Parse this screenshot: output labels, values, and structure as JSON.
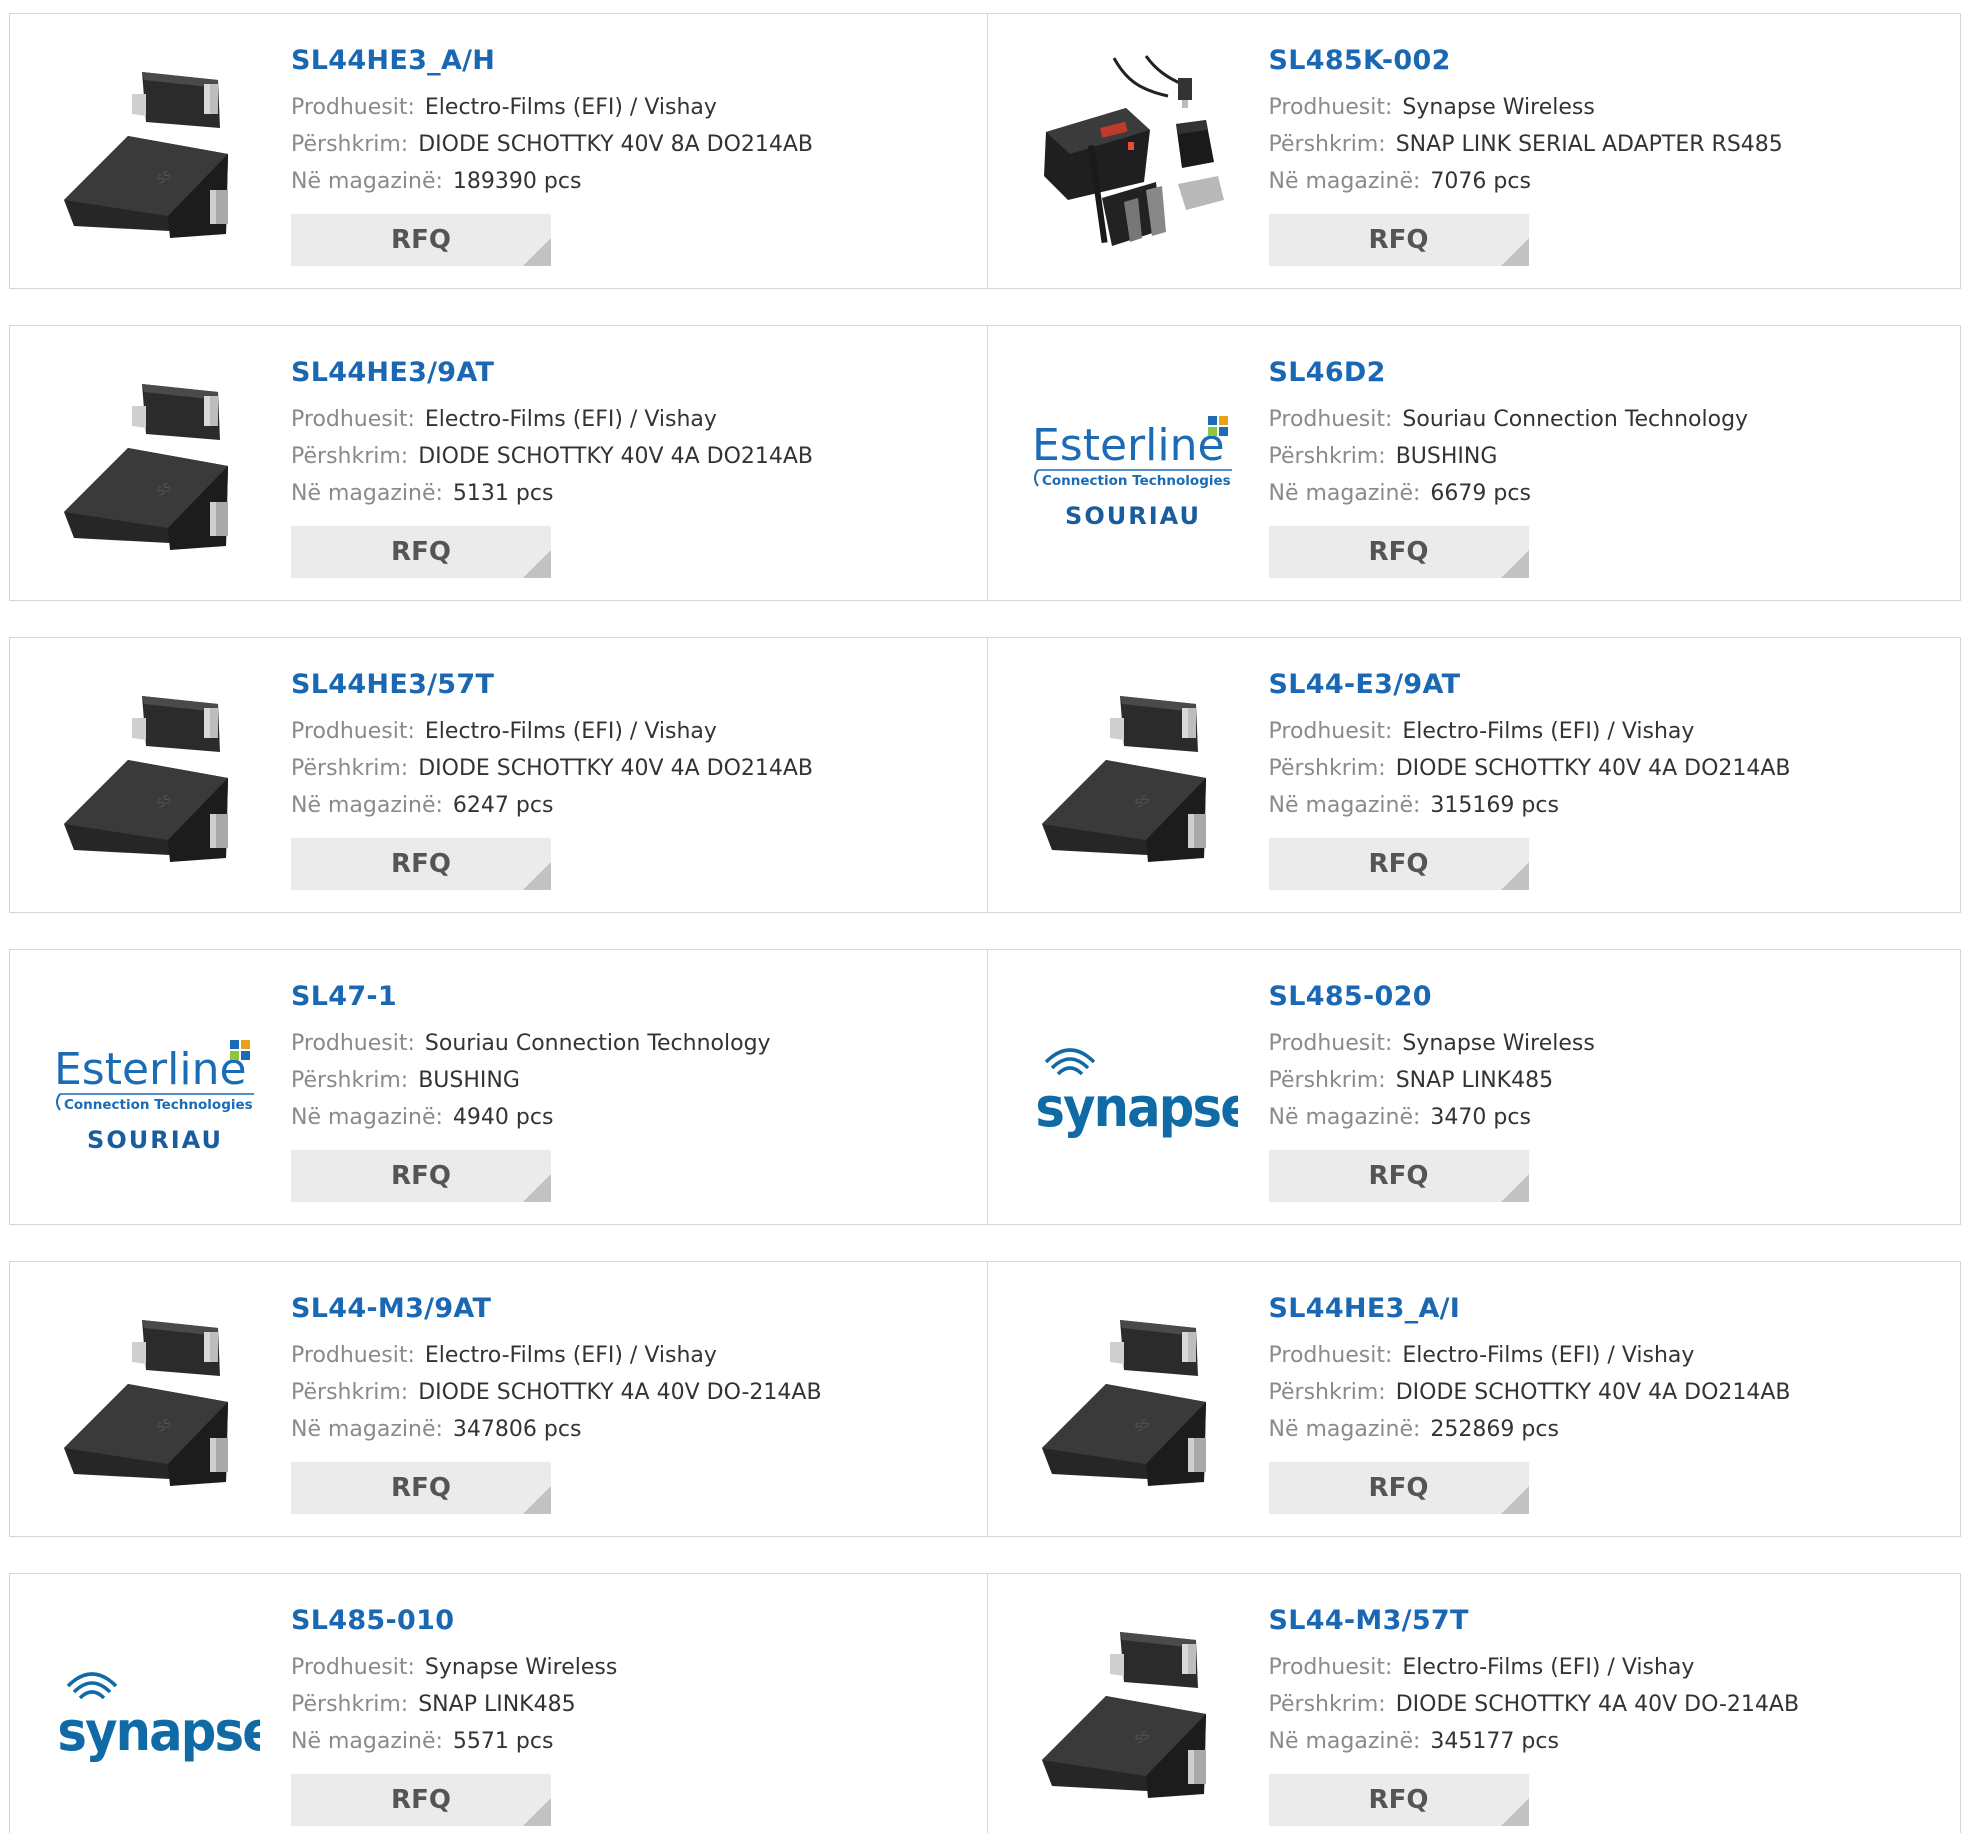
{
  "labels": {
    "manufacturer": "Prodhuesit:",
    "description": "Përshkrim:",
    "stock": "Në magazinë:",
    "rfq": "RFQ"
  },
  "logos": {
    "esterline": {
      "name": "Esterline",
      "sub": "Connection Technologies",
      "brand": "SOURIAU"
    },
    "synapse": {
      "name": "Synapse"
    }
  },
  "colors": {
    "link": "#1a67b4",
    "label": "#8a8a8a",
    "value": "#333333",
    "rfq_bg": "#ebebeb",
    "rfq_corner": "#c2c2c2",
    "border": "#d5d5d5"
  },
  "products": [
    {
      "part": "SL44HE3_A/H",
      "manufacturer": "Electro-Films (EFI) / Vishay",
      "description": "DIODE SCHOTTKY 40V 8A DO214AB",
      "stock": "189390 pcs",
      "image": "diode"
    },
    {
      "part": "SL485K-002",
      "manufacturer": "Synapse Wireless",
      "description": "SNAP LINK SERIAL ADAPTER RS485",
      "stock": "7076 pcs",
      "image": "adapter-kit"
    },
    {
      "part": "SL44HE3/9AT",
      "manufacturer": "Electro-Films (EFI) / Vishay",
      "description": "DIODE SCHOTTKY 40V 4A DO214AB",
      "stock": "5131 pcs",
      "image": "diode"
    },
    {
      "part": "SL46D2",
      "manufacturer": "Souriau Connection Technology",
      "description": "BUSHING",
      "stock": "6679 pcs",
      "image": "esterline-logo"
    },
    {
      "part": "SL44HE3/57T",
      "manufacturer": "Electro-Films (EFI) / Vishay",
      "description": "DIODE SCHOTTKY 40V 4A DO214AB",
      "stock": "6247 pcs",
      "image": "diode"
    },
    {
      "part": "SL44-E3/9AT",
      "manufacturer": "Electro-Films (EFI) / Vishay",
      "description": "DIODE SCHOTTKY 40V 4A DO214AB",
      "stock": "315169 pcs",
      "image": "diode"
    },
    {
      "part": "SL47-1",
      "manufacturer": "Souriau Connection Technology",
      "description": "BUSHING",
      "stock": "4940 pcs",
      "image": "esterline-logo"
    },
    {
      "part": "SL485-020",
      "manufacturer": "Synapse Wireless",
      "description": "SNAP LINK485",
      "stock": "3470 pcs",
      "image": "synapse-logo"
    },
    {
      "part": "SL44-M3/9AT",
      "manufacturer": "Electro-Films (EFI) / Vishay",
      "description": "DIODE SCHOTTKY 4A 40V DO-214AB",
      "stock": "347806 pcs",
      "image": "diode"
    },
    {
      "part": "SL44HE3_A/I",
      "manufacturer": "Electro-Films (EFI) / Vishay",
      "description": "DIODE SCHOTTKY 40V 4A DO214AB",
      "stock": "252869 pcs",
      "image": "diode"
    },
    {
      "part": "SL485-010",
      "manufacturer": "Synapse Wireless",
      "description": "SNAP LINK485",
      "stock": "5571 pcs",
      "image": "synapse-logo"
    },
    {
      "part": "SL44-M3/57T",
      "manufacturer": "Electro-Films (EFI) / Vishay",
      "description": "DIODE SCHOTTKY 4A 40V DO-214AB",
      "stock": "345177 pcs",
      "image": "diode"
    }
  ]
}
